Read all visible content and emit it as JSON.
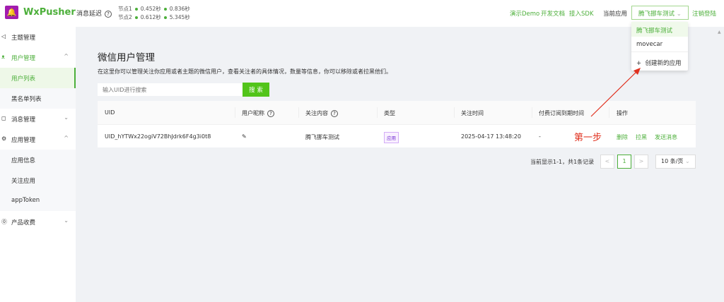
{
  "header": {
    "brand": "WxPusher",
    "latency_label": "消息延迟",
    "nodes": [
      {
        "name": "节点1",
        "v1": "0.452秒",
        "v2": "0.836秒"
      },
      {
        "name": "节点2",
        "v1": "0.612秒",
        "v2": "5.345秒"
      }
    ],
    "links": [
      "演示Demo",
      "开发文档",
      "接入SDK"
    ],
    "current_app_label": "当前应用",
    "current_app": "腾飞挪车测试",
    "logout": "注销登陆"
  },
  "app_dropdown": {
    "options": [
      "腾飞挪车测试",
      "movecar"
    ],
    "create": "创建新的应用"
  },
  "sidebar": [
    {
      "label": "主题管理"
    },
    {
      "label": "用户管理"
    },
    {
      "label": "用户列表"
    },
    {
      "label": "黑名单列表"
    },
    {
      "label": "消息管理"
    },
    {
      "label": "应用管理"
    },
    {
      "label": "应用信息"
    },
    {
      "label": "关注应用"
    },
    {
      "label": "appToken"
    },
    {
      "label": "产品收费"
    }
  ],
  "main": {
    "title": "微信用户管理",
    "description": "在这里你可以管理关注你应用或者主题的微信用户，查看关注者的具体情况，数量等信息，你可以移除或者拉黑他们。",
    "search_placeholder": "输入UID进行搜索",
    "search_button": "搜 索"
  },
  "table": {
    "headers": [
      "UID",
      "用户昵称",
      "关注内容",
      "类型",
      "关注时间",
      "付费订阅到期时间",
      "操作"
    ],
    "rows": [
      {
        "uid": "UID_hYTWx22ogiV72BhJdrk6F4g3i0t8",
        "content": "腾飞挪车测试",
        "type": "应用",
        "time": "2025-04-17 13:48:20",
        "expire": "-",
        "actions": [
          "删除",
          "拉黑",
          "发送消息"
        ]
      }
    ]
  },
  "pagination": {
    "summary": "当前显示1-1，共1条记录",
    "page": "1",
    "page_size": "10 条/页"
  },
  "annotation": {
    "text": "第一步",
    "color": "#e0301e"
  },
  "colors": {
    "brand": "#4caf3a",
    "logo": "#a21caf"
  }
}
